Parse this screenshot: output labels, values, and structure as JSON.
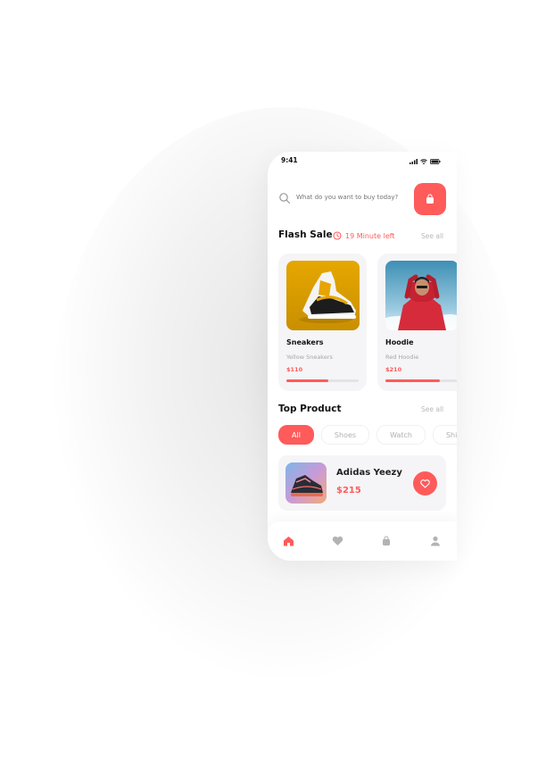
{
  "status_bar": {
    "time": "9:41"
  },
  "search": {
    "placeholder": "What do you want to buy today?"
  },
  "flash_sale": {
    "title": "Flash Sale",
    "timer": "19 Minute left",
    "see_all": "See all",
    "items": [
      {
        "name": "Sneakers",
        "subtitle": "Yellow Sneakers",
        "price": "$110",
        "progress": 0.58
      },
      {
        "name": "Hoodie",
        "subtitle": "Red Hoodie",
        "price": "$210",
        "progress": 0.75
      }
    ]
  },
  "top_product": {
    "title": "Top Product",
    "see_all": "See all",
    "chips": [
      "All",
      "Shoes",
      "Watch",
      "Shir"
    ],
    "item": {
      "name": "Adidas Yeezy",
      "price": "$215"
    }
  },
  "colors": {
    "accent": "#ff5b5b",
    "card_bg": "#f5f5f7",
    "muted": "#b0b0b0"
  },
  "nav": {
    "icons": [
      "home-icon",
      "heart-icon",
      "bag-icon",
      "user-icon"
    ]
  }
}
